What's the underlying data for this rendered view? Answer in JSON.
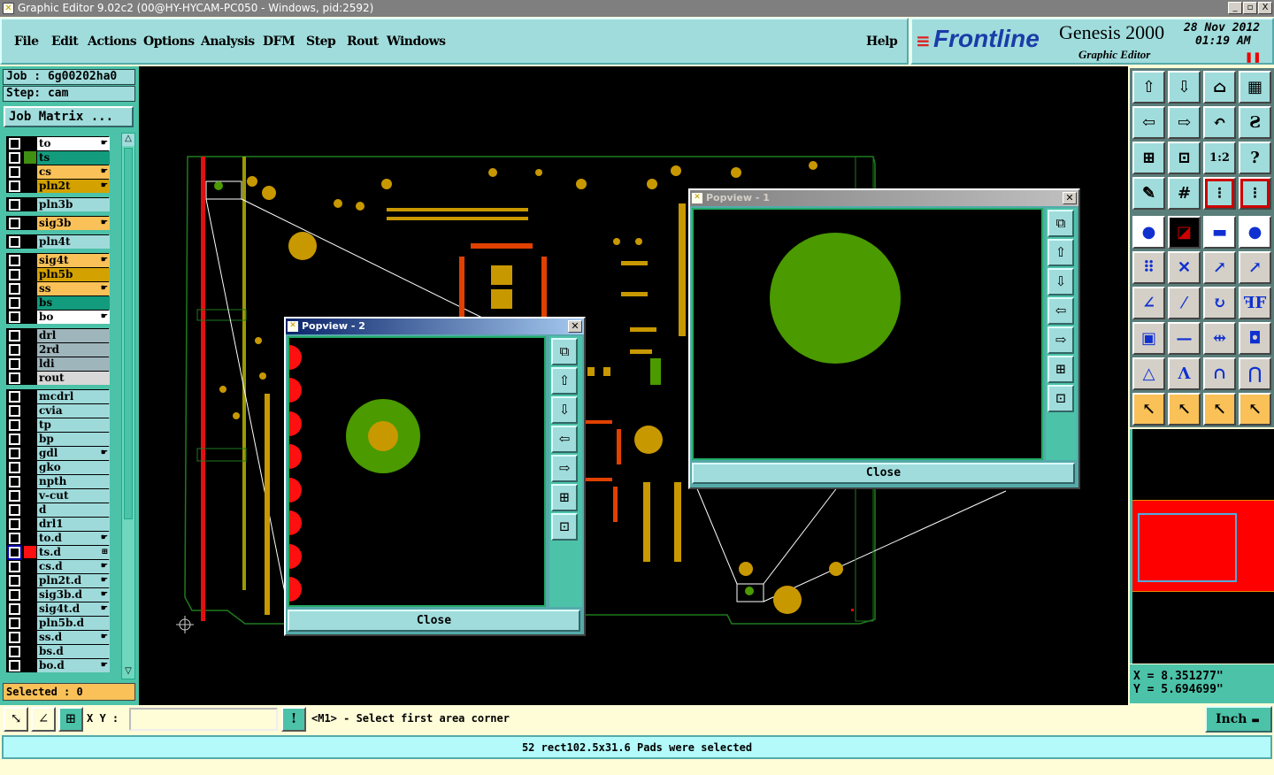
{
  "window": {
    "title": "Graphic Editor 9.02c2 (00@HY-HYCAM-PC050 - Windows, pid:2592)",
    "controls": [
      "_",
      "▫",
      "X"
    ]
  },
  "menu": [
    "File",
    "Edit",
    "Actions",
    "Options",
    "Analysis",
    "DFM",
    "Step",
    "Rout",
    "Windows"
  ],
  "help": "Help",
  "brand": {
    "logo": "Frontline",
    "product": "Genesis 2000",
    "subtitle": "Graphic Editor",
    "date": "28 Nov 2012",
    "time": "01:19 AM"
  },
  "job": {
    "job_label": "Job : 6g00202ha0",
    "step_label": "Step: cam",
    "job_matrix": "Job Matrix ..."
  },
  "layer_groups": [
    [
      {
        "name": "to",
        "color": "#ffffff",
        "arrow": true
      },
      {
        "name": "ts",
        "color": "#139b7d",
        "swatch": "#3f8f10"
      },
      {
        "name": "cs",
        "color": "#f9c158",
        "arrow": true
      },
      {
        "name": "pln2t",
        "color": "#d4a200",
        "arrow": true
      }
    ],
    [
      {
        "name": "pln3b",
        "color": "#9fdadb"
      }
    ],
    [
      {
        "name": "sig3b",
        "color": "#f9c158",
        "arrow": true
      }
    ],
    [
      {
        "name": "pln4t",
        "color": "#9fdadb"
      }
    ],
    [
      {
        "name": "sig4t",
        "color": "#f9c158",
        "arrow": true
      },
      {
        "name": "pln5b",
        "color": "#d4a200"
      },
      {
        "name": "ss",
        "color": "#f9c158",
        "arrow": true
      },
      {
        "name": "bs",
        "color": "#139b7d"
      },
      {
        "name": "bo",
        "color": "#ffffff",
        "arrow": true
      }
    ],
    [
      {
        "name": "drl",
        "color": "#9fb5bc"
      },
      {
        "name": "2rd",
        "color": "#9fb5bc"
      },
      {
        "name": "ldi",
        "color": "#9fb5bc"
      },
      {
        "name": "rout",
        "color": "#d8d8d8"
      }
    ],
    [
      {
        "name": "mcdrl",
        "color": "#9fdadb"
      },
      {
        "name": "cvia",
        "color": "#9fdadb"
      },
      {
        "name": "tp",
        "color": "#9fdadb"
      },
      {
        "name": "bp",
        "color": "#9fdadb"
      },
      {
        "name": "gdl",
        "color": "#9fdadb",
        "arrow": true
      },
      {
        "name": "gko",
        "color": "#9fdadb"
      },
      {
        "name": "npth",
        "color": "#9fdadb"
      },
      {
        "name": "v-cut",
        "color": "#9fdadb"
      },
      {
        "name": "d",
        "color": "#9fdadb"
      },
      {
        "name": "drl1",
        "color": "#9fdadb"
      },
      {
        "name": "to.d",
        "color": "#9fdadb",
        "arrow": true
      },
      {
        "name": "ts.d",
        "color": "#9fdadb",
        "swatch": "#ff1010",
        "selected": true,
        "marker": "⊞"
      },
      {
        "name": "cs.d",
        "color": "#9fdadb",
        "arrow": true
      },
      {
        "name": "pln2t.d",
        "color": "#9fdadb",
        "arrow": true
      },
      {
        "name": "sig3b.d",
        "color": "#9fdadb",
        "arrow": true
      },
      {
        "name": "sig4t.d",
        "color": "#9fdadb",
        "arrow": true
      },
      {
        "name": "pln5b.d",
        "color": "#9fdadb"
      },
      {
        "name": "ss.d",
        "color": "#9fdadb",
        "arrow": true
      },
      {
        "name": "bs.d",
        "color": "#9fdadb"
      },
      {
        "name": "bo.d",
        "color": "#9fdadb",
        "arrow": true
      }
    ]
  ],
  "selected_label": "Selected : 0",
  "popview1": {
    "title": "Popview - 1",
    "close": "Close"
  },
  "popview2": {
    "title": "Popview - 2",
    "close": "Close"
  },
  "popview_tools": [
    "zoom-back-icon",
    "pan-up-icon",
    "pan-down-icon",
    "pan-left-icon",
    "pan-right-icon",
    "zoom-in-icon",
    "zoom-out-icon"
  ],
  "toolbar": [
    {
      "icon": "pan-up-icon",
      "glyph": "⇧",
      "bg": "#a0dcdc"
    },
    {
      "icon": "pan-down-icon",
      "glyph": "⇩",
      "bg": "#a0dcdc"
    },
    {
      "icon": "home-icon",
      "glyph": "⌂",
      "bg": "#a0dcdc"
    },
    {
      "icon": "grid-xy-icon",
      "glyph": "▦",
      "bg": "#a0dcdc"
    },
    {
      "icon": "pan-left-icon",
      "glyph": "⇦",
      "bg": "#a0dcdc"
    },
    {
      "icon": "pan-right-icon",
      "glyph": "⇨",
      "bg": "#a0dcdc"
    },
    {
      "icon": "undo-view-icon",
      "glyph": "↶",
      "bg": "#a0dcdc"
    },
    {
      "icon": "snap-icon",
      "glyph": "Ƨ",
      "bg": "#a0dcdc"
    },
    {
      "icon": "zoom-in-icon",
      "glyph": "⊞",
      "bg": "#a0dcdc"
    },
    {
      "icon": "zoom-out-icon",
      "glyph": "⊡",
      "bg": "#a0dcdc"
    },
    {
      "icon": "scale-1-2-icon",
      "glyph": "1:2",
      "bg": "#a0dcdc"
    },
    {
      "icon": "help-icon",
      "glyph": "?",
      "bg": "#a0dcdc"
    },
    {
      "icon": "tools-palette-icon",
      "glyph": "✎",
      "bg": "#a0dcdc"
    },
    {
      "icon": "grid-icon",
      "glyph": "#",
      "bg": "#a0dcdc"
    },
    {
      "icon": "layer-color-icon",
      "glyph": "⁝",
      "bg": "#a0dcdc",
      "border": "#c00"
    },
    {
      "icon": "layer-red-icon",
      "glyph": "⁝",
      "bg": "#a0dcdc",
      "border": "#c00"
    },
    {
      "icon": "add-feature-icon",
      "glyph": "●",
      "bg": "#ffffff"
    },
    {
      "icon": "measure-area-icon",
      "glyph": "◪",
      "bg": "#000000"
    },
    {
      "icon": "ruler-icon",
      "glyph": "▬",
      "bg": "#ffffff"
    },
    {
      "icon": "pad-icon",
      "glyph": "●",
      "bg": "#ffffff"
    },
    {
      "icon": "connect-icon",
      "glyph": "⠿",
      "bg": "#d4d0c8"
    },
    {
      "icon": "cut-line-icon",
      "glyph": "✕",
      "bg": "#d4d0c8"
    },
    {
      "icon": "move-pad-icon",
      "glyph": "↗",
      "bg": "#d4d0c8"
    },
    {
      "icon": "move-pad-fill-icon",
      "glyph": "↗",
      "bg": "#d4d0c8"
    },
    {
      "icon": "angle-line-icon",
      "glyph": "∠",
      "bg": "#d4d0c8"
    },
    {
      "icon": "slash-line-icon",
      "glyph": "⁄",
      "bg": "#d4d0c8"
    },
    {
      "icon": "rotate-icon",
      "glyph": "↻",
      "bg": "#d4d0c8"
    },
    {
      "icon": "mirror-icon",
      "glyph": "ꟻF",
      "bg": "#d4d0c8"
    },
    {
      "icon": "move-square-icon",
      "glyph": "▣",
      "bg": "#d4d0c8"
    },
    {
      "icon": "line-segment-icon",
      "glyph": "—",
      "bg": "#d4d0c8"
    },
    {
      "icon": "dimension-icon",
      "glyph": "⇹",
      "bg": "#d4d0c8"
    },
    {
      "icon": "shapes-icon",
      "glyph": "◘",
      "bg": "#d4d0c8"
    },
    {
      "icon": "triangle-icon",
      "glyph": "△",
      "bg": "#d4d0c8"
    },
    {
      "icon": "arc-icon",
      "glyph": "Λ",
      "bg": "#d4d0c8"
    },
    {
      "icon": "arch-icon",
      "glyph": "∩",
      "bg": "#d4d0c8"
    },
    {
      "icon": "arch-cut-icon",
      "glyph": "⋂",
      "bg": "#d4d0c8"
    },
    {
      "icon": "select-icon",
      "glyph": "↖",
      "bg": "#f9c158"
    },
    {
      "icon": "select-box-icon",
      "glyph": "↖",
      "bg": "#f9c158"
    },
    {
      "icon": "select-polygon-icon",
      "glyph": "↖",
      "bg": "#f9c158"
    },
    {
      "icon": "select-net-icon",
      "glyph": "↖",
      "bg": "#f9c158"
    }
  ],
  "coords": {
    "x": "X = 8.351277\"",
    "y": "Y = 5.694699\""
  },
  "command": {
    "xy_label": "X Y :",
    "xy_value": "",
    "prompt": "<M1> - Select first area corner",
    "units": "Inch"
  },
  "status": "52 rect102.5x31.6 Pads were selected",
  "colors": {
    "panel": "#a0dcdc",
    "accent": "#4cc2a8",
    "copper": "#c89800",
    "mask": "#4a9a00",
    "highlight": "#ff1010"
  }
}
